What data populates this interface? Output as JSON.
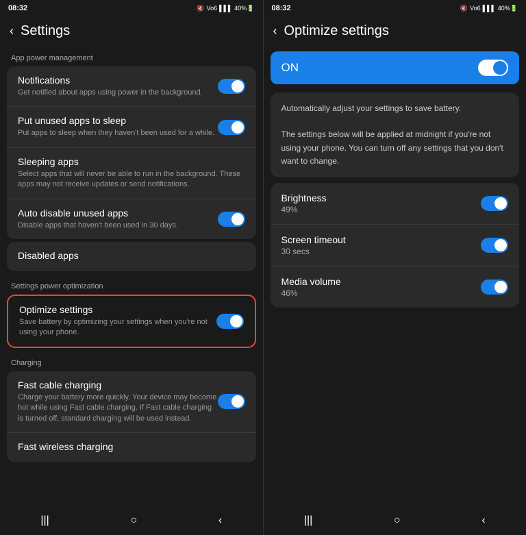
{
  "left": {
    "status": {
      "time": "08:32",
      "icons": "⊕ b ···  Vo6  40%"
    },
    "header": {
      "back": "‹",
      "title": "Settings"
    },
    "sections": [
      {
        "label": "App power management",
        "items": [
          {
            "title": "Notifications",
            "subtitle": "Get notified about apps using power in the background.",
            "toggle": true
          },
          {
            "title": "Put unused apps to sleep",
            "subtitle": "Put apps to sleep when they haven't been used for a while.",
            "toggle": true
          },
          {
            "title": "Sleeping apps",
            "subtitle": "Select apps that will never be able to run in the background. These apps may not receive updates or send notifications.",
            "toggle": false
          },
          {
            "title": "Auto disable unused apps",
            "subtitle": "Disable apps that haven't been used in 30 days.",
            "toggle": true
          }
        ]
      }
    ],
    "disabled_apps": "Disabled apps",
    "optimization_label": "Settings power optimization",
    "optimize_item": {
      "title": "Optimize settings",
      "subtitle": "Save battery by optimizing your settings when you're not using your phone.",
      "toggle": true
    },
    "charging_label": "Charging",
    "charging_items": [
      {
        "title": "Fast cable charging",
        "subtitle": "Charge your battery more quickly. Your device may become hot while using Fast cable charging. If Fast cable charging is turned off, standard charging will be used instead.",
        "toggle": true
      },
      {
        "title": "Fast wireless charging",
        "subtitle": "",
        "toggle": false
      }
    ],
    "nav": {
      "menu": "|||",
      "home": "○",
      "back": "‹"
    }
  },
  "right": {
    "status": {
      "time": "08:32",
      "icons": "⊕ b ···  Vo6  40%"
    },
    "header": {
      "back": "‹",
      "title": "Optimize settings"
    },
    "on_label": "ON",
    "description": "Automatically adjust your settings to save battery.\n\nThe settings below will be applied at midnight if you're not using your phone. You can turn off any settings that you don't want to change.",
    "items": [
      {
        "title": "Brightness",
        "subtitle": "49%",
        "toggle": true
      },
      {
        "title": "Screen timeout",
        "subtitle": "30 secs",
        "toggle": true
      },
      {
        "title": "Media volume",
        "subtitle": "46%",
        "toggle": true
      }
    ],
    "nav": {
      "menu": "|||",
      "home": "○",
      "back": "‹"
    }
  }
}
